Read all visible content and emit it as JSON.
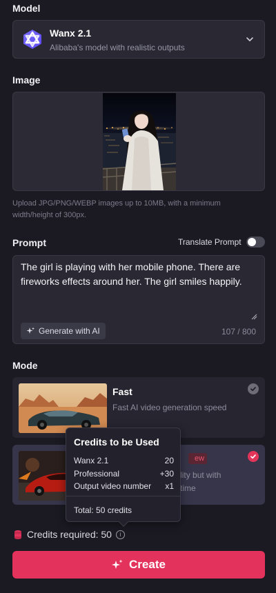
{
  "model": {
    "label": "Model",
    "name": "Wanx 2.1",
    "description": "Alibaba's model with realistic outputs"
  },
  "image": {
    "label": "Image",
    "hint": "Upload JPG/PNG/WEBP images up to 10MB, with a minimum width/height of 300px."
  },
  "prompt": {
    "label": "Prompt",
    "translate_label": "Translate Prompt",
    "translate_on": false,
    "text": "The girl is playing with her mobile phone. There are fireworks effects around her. The girl smiles happily.",
    "generate_label": "Generate with AI",
    "counter": "107 / 800"
  },
  "mode": {
    "label": "Mode",
    "fast": {
      "title": "Fast",
      "description": "Fast AI video generation speed"
    },
    "pro": {
      "badge": "ew",
      "desc_line1": "quality but with",
      "desc_line2": "time"
    }
  },
  "tooltip": {
    "title": "Credits to be Used",
    "rows": [
      {
        "label": "Wanx 2.1",
        "value": "20"
      },
      {
        "label": "Professional",
        "value": "+30"
      },
      {
        "label": "Output video number",
        "value": "x1"
      }
    ],
    "total": "Total: 50 credits"
  },
  "credits": {
    "text": "Credits required: 50"
  },
  "create_label": "Create",
  "colors": {
    "accent": "#e3335c",
    "background": "#1b1a23",
    "card": "#292833"
  }
}
